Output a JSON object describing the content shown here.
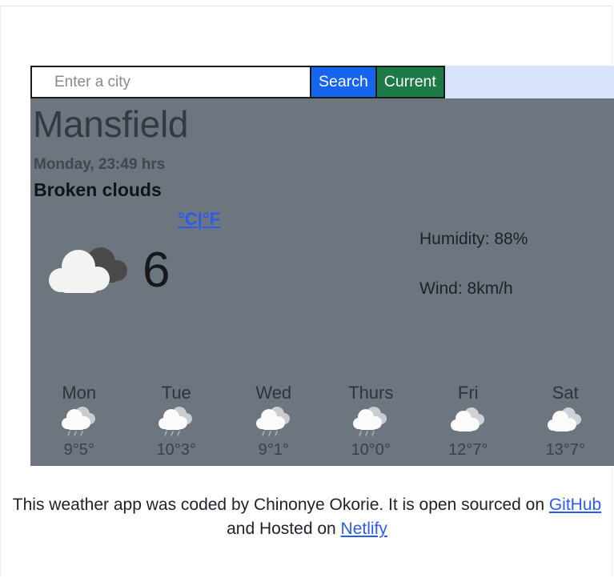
{
  "search": {
    "placeholder": "Enter a city",
    "value": "",
    "search_label": "Search",
    "current_label": "Current"
  },
  "weather": {
    "city": "Mansfield",
    "datetime": "Monday, 23:49 hrs",
    "description": "Broken clouds",
    "temperature": "6",
    "unit_celsius": "°C",
    "unit_separator": "|",
    "unit_fahrenheit": "°F",
    "humidity": "Humidity: 88%",
    "wind": "Wind: 8km/h",
    "icon": "broken-clouds-icon"
  },
  "forecast": [
    {
      "day": "Mon",
      "icon": "rain-cloud-icon",
      "temps": "9°5°"
    },
    {
      "day": "Tue",
      "icon": "rain-cloud-icon",
      "temps": "10°3°"
    },
    {
      "day": "Wed",
      "icon": "rain-cloud-icon",
      "temps": "9°1°"
    },
    {
      "day": "Thurs",
      "icon": "rain-cloud-icon",
      "temps": "10°0°"
    },
    {
      "day": "Fri",
      "icon": "cloud-icon",
      "temps": "12°7°"
    },
    {
      "day": "Sat",
      "icon": "cloud-icon",
      "temps": "13°7°"
    }
  ],
  "footer": {
    "text_before": "This weather app was coded by Chinonye Okorie. It is open sourced on ",
    "github_label": "GitHub",
    "text_middle": " and Hosted on ",
    "netlify_label": "Netlify"
  },
  "colors": {
    "card_background": "#6d757f",
    "search_button": "#1565f0",
    "current_button": "#1b7a45",
    "form_background": "#d7e3fb",
    "link": "#2a5bf5"
  }
}
